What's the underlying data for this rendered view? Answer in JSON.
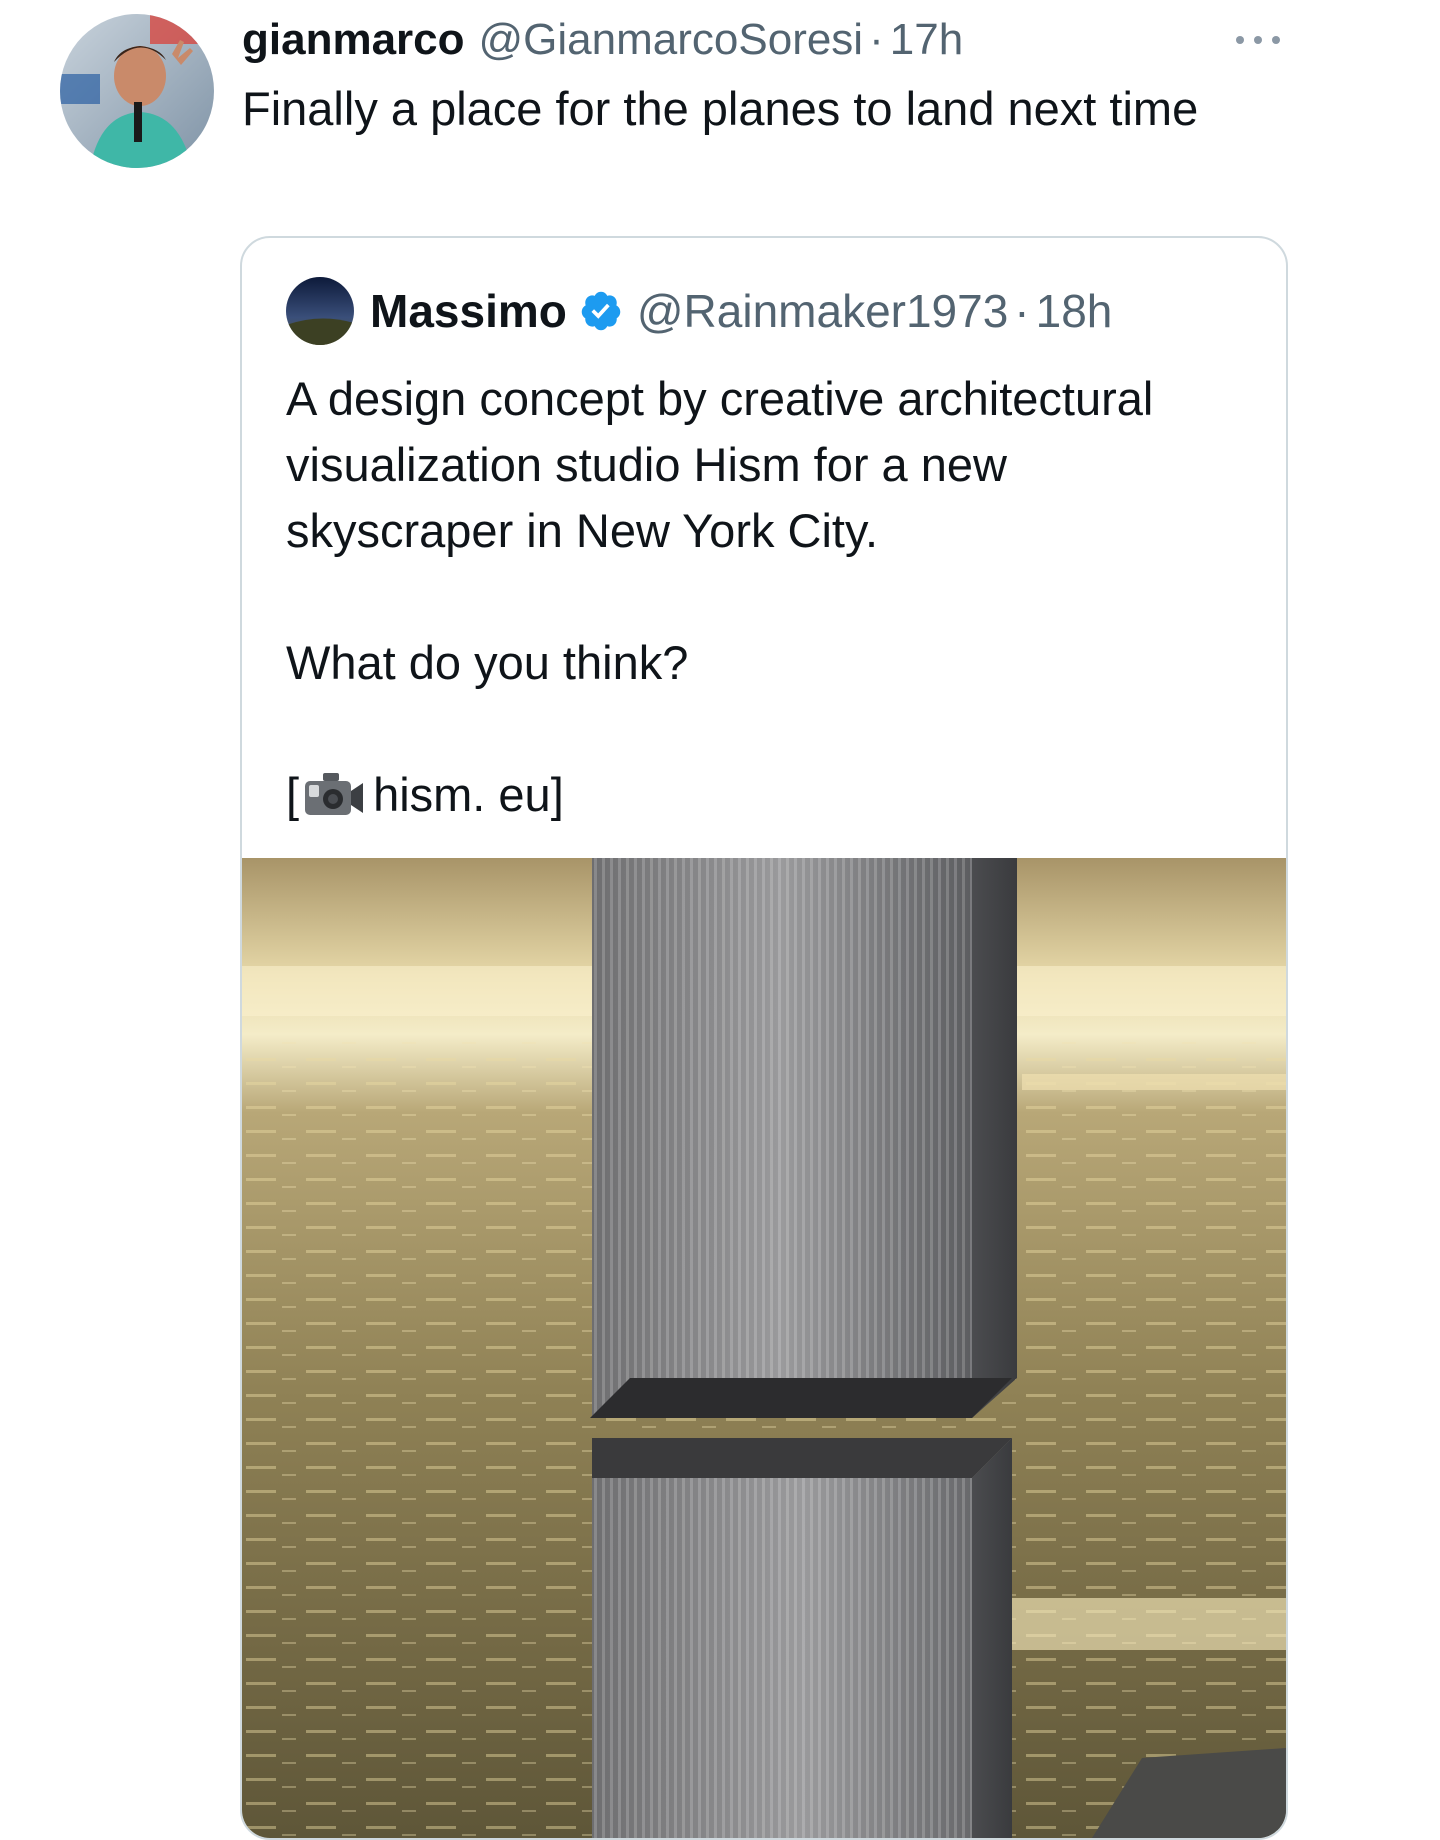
{
  "tweet": {
    "display_name": "gianmarco",
    "handle": "@GianmarcoSoresi",
    "separator": "·",
    "timestamp": "17h",
    "text": "Finally a place for the planes to land next time",
    "avatar_icon": "user-avatar",
    "more_icon": "more-options-icon"
  },
  "quoted_tweet": {
    "display_name": "Massimo",
    "verified": true,
    "verified_color": "#1d9bf0",
    "handle": "@Rainmaker1973",
    "separator": "·",
    "timestamp": "18h",
    "paragraph_1": "A design concept by creative architectural visualization studio Hism for a new skyscraper in New York City.",
    "paragraph_2": "What do you think?",
    "link_open": "[",
    "link_text": "hism. eu]",
    "link_icon": "video-camera-icon",
    "media": {
      "type": "image",
      "subject": "skyscraper-render"
    }
  },
  "colors": {
    "text_primary": "#0f1419",
    "text_secondary": "#536471",
    "border": "#cfd9de",
    "verified": "#1d9bf0"
  }
}
